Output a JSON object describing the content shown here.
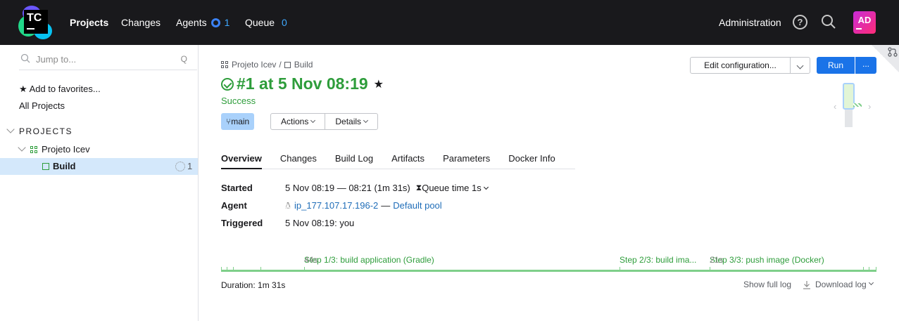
{
  "topbar": {
    "logo_text": "TC",
    "nav": {
      "projects": "Projects",
      "changes": "Changes",
      "agents": "Agents",
      "agents_count": "1",
      "queue": "Queue",
      "queue_count": "0"
    },
    "administration": "Administration",
    "help_icon": "?",
    "avatar_initials": "AD"
  },
  "sidebar": {
    "search_placeholder": "Jump to...",
    "search_hotkey": "Q",
    "favorites": "Add to favorites...",
    "all_projects": "All Projects",
    "section_title": "PROJECTS",
    "project_name": "Projeto Icev",
    "build_name": "Build",
    "build_running_count": "1"
  },
  "breadcrumb": {
    "project": "Projeto Icev",
    "separator": "/",
    "build": "Build"
  },
  "build": {
    "title": "#1 at 5 Nov 08:19",
    "status": "Success",
    "branch": "main",
    "actions_label": "Actions",
    "details_label": "Details"
  },
  "toolbar": {
    "edit_label": "Edit configuration...",
    "run_label": "Run",
    "more_label": "..."
  },
  "tabs": [
    "Overview",
    "Changes",
    "Build Log",
    "Artifacts",
    "Parameters",
    "Docker Info"
  ],
  "details": {
    "started_label": "Started",
    "started_value": "5 Nov 08:19 — 08:21 (1m 31s)",
    "queue_time": "Queue time 1s",
    "agent_label": "Agent",
    "agent_name": "ip_177.107.17.196-2",
    "agent_pool_sep": "—",
    "agent_pool": "Default pool",
    "triggered_label": "Triggered",
    "triggered_value": "5 Nov 08:19: you"
  },
  "steps": [
    {
      "name": "Step 1/3: build application (Gradle)",
      "duration": "44s"
    },
    {
      "name": "Step 2/3: build ima...",
      "duration": ""
    },
    {
      "name": "Step 3/3: push image (Docker)",
      "duration": "21s"
    }
  ],
  "footer": {
    "duration": "Duration: 1m 31s",
    "show_full_log": "Show full log",
    "download_log": "Download log"
  },
  "colors": {
    "success": "#2e9d3b",
    "accent": "#1a73e8",
    "topbar_bg": "#19191c",
    "selected_bg": "#d4e8fb"
  }
}
